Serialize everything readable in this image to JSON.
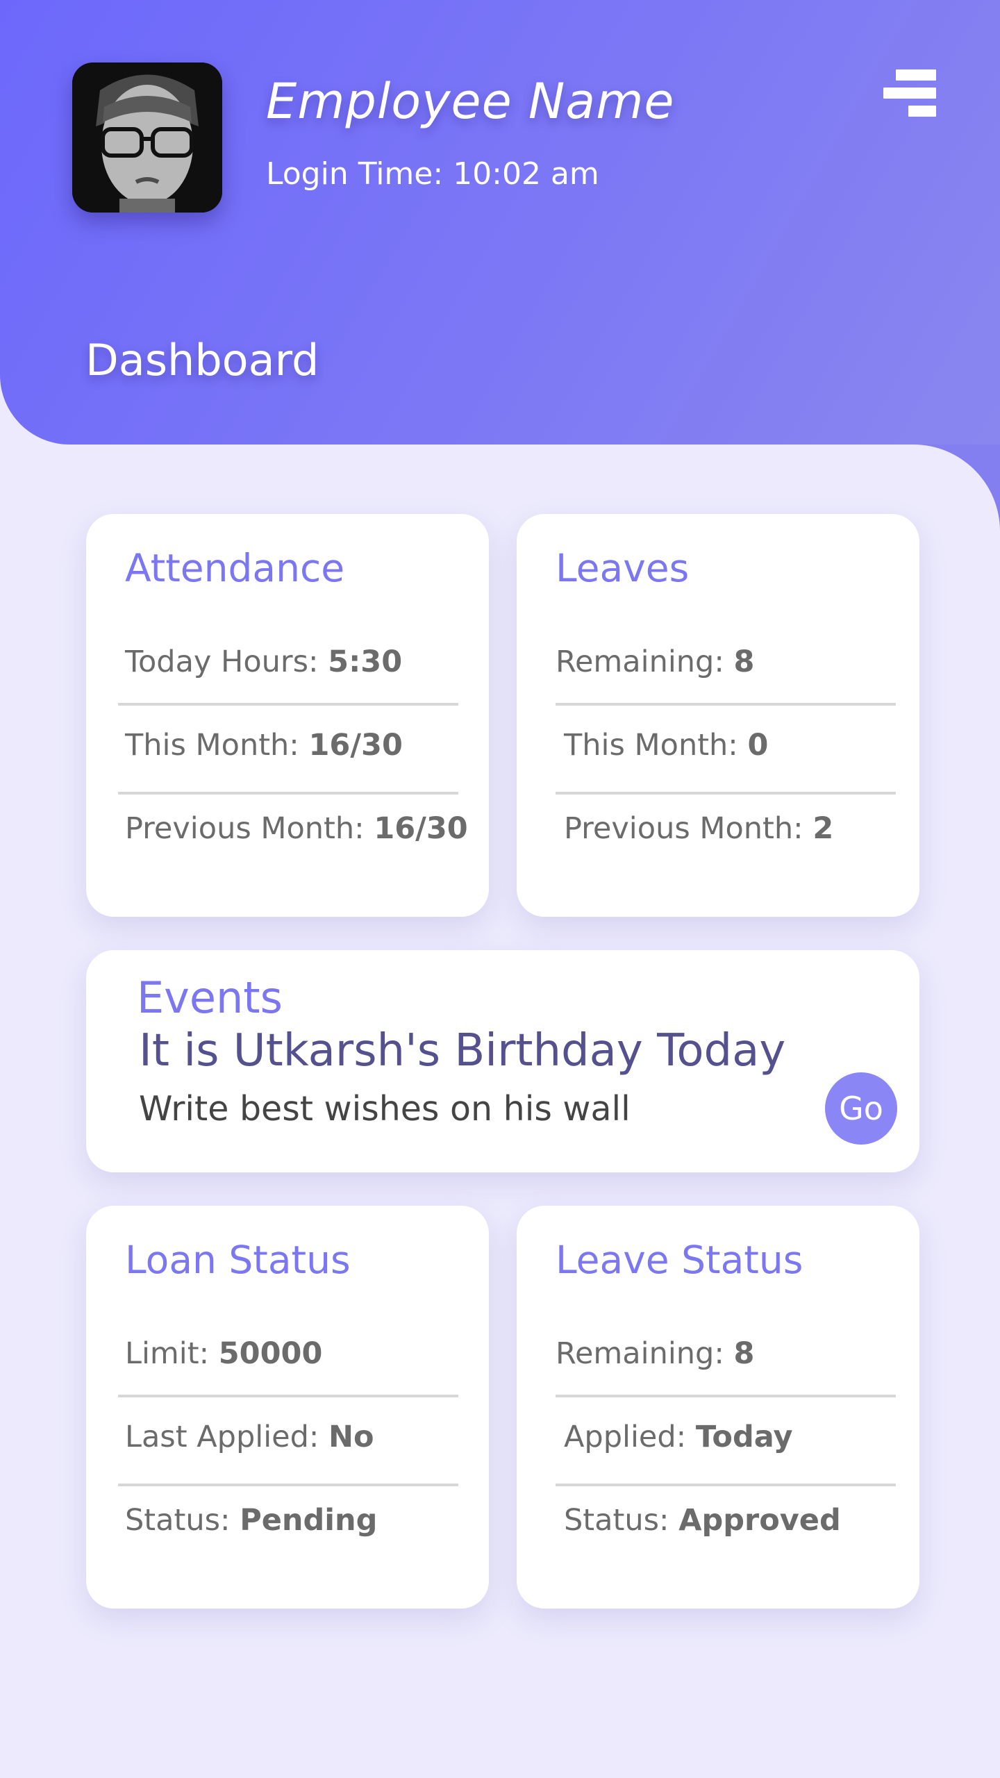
{
  "header": {
    "employee_name": "Employee Name",
    "login_time": "Login Time: 10:02 am",
    "avatar_alt": "employee-photo",
    "menu_icon": "menu-icon"
  },
  "page_title": "Dashboard",
  "attendance": {
    "title": "Attendance",
    "rows": [
      {
        "label": "Today Hours:",
        "value": "5:30"
      },
      {
        "label": "This Month:",
        "value": "16/30"
      },
      {
        "label": "Previous Month:",
        "value": "16/30"
      }
    ]
  },
  "leaves": {
    "title": "Leaves",
    "rows": [
      {
        "label": "Remaining:",
        "value": "8"
      },
      {
        "label": "This Month:",
        "value": "0"
      },
      {
        "label": "Previous Month:",
        "value": "2"
      }
    ]
  },
  "events": {
    "title": "Events",
    "headline": "It is Utkarsh's Birthday Today",
    "subtext": "Write best wishes on his wall",
    "go_label": "Go"
  },
  "loan_status": {
    "title": "Loan Status",
    "rows": [
      {
        "label": "Limit:",
        "value": "50000"
      },
      {
        "label": "Last Applied:",
        "value": "No"
      },
      {
        "label": "Status:",
        "value": "Pending"
      }
    ]
  },
  "leave_status": {
    "title": "Leave Status",
    "rows": [
      {
        "label": "Remaining:",
        "value": "8"
      },
      {
        "label": "Applied:",
        "value": "Today"
      },
      {
        "label": "Status:",
        "value": "Approved"
      }
    ]
  },
  "colors": {
    "header_gradient_start": "#6d68fb",
    "header_gradient_end": "#8a86ef",
    "accent": "#7b77f2",
    "page_background": "#eceafc",
    "card_background": "#ffffff",
    "event_headline": "#55518f",
    "go_button": "#8a86f5"
  }
}
